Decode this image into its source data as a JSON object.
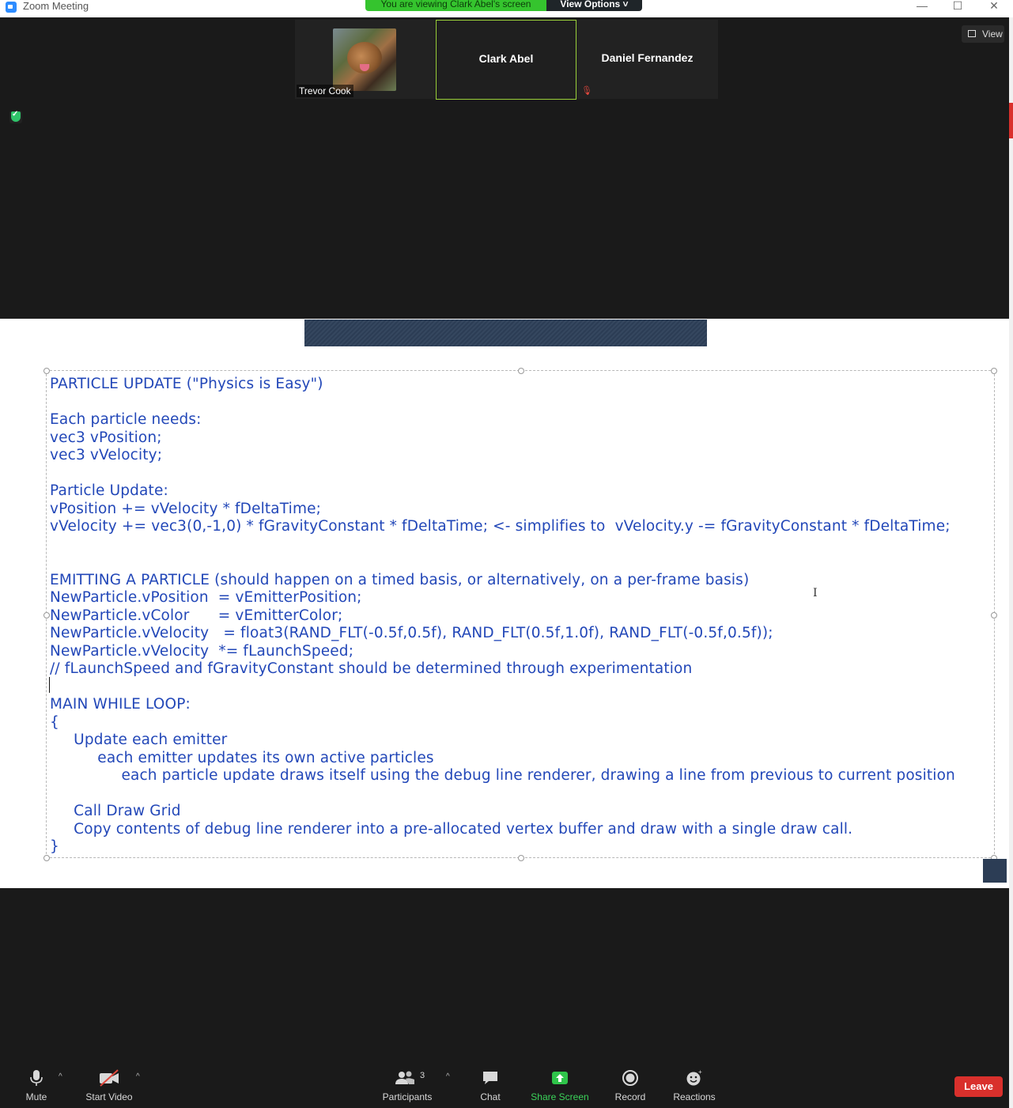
{
  "window": {
    "title": "Zoom Meeting",
    "viewing_banner": "You are viewing Clark Abel's screen",
    "view_options": "View Options ˅",
    "controls": [
      "—",
      "☐",
      "✕"
    ]
  },
  "participants_strip": {
    "trevor": "Trevor Cook",
    "clark": "Clark Abel",
    "daniel": "Daniel Fernandez"
  },
  "view_button": "View",
  "shared_screen": {
    "lines": [
      "PARTICLE UPDATE (\"Physics is Easy\")",
      "",
      "Each particle needs:",
      "vec3 vPosition;",
      "vec3 vVelocity;",
      "",
      "Particle Update:",
      "vPosition += vVelocity * fDeltaTime;",
      "vVelocity += vec3(0,-1,0) * fGravityConstant * fDeltaTime; <- simplifies to  vVelocity.y -= fGravityConstant * fDeltaTime;",
      "",
      "",
      "EMITTING A PARTICLE (should happen on a timed basis, or alternatively, on a per-frame basis)",
      "NewParticle.vPosition  = vEmitterPosition;",
      "NewParticle.vColor      = vEmitterColor;",
      "NewParticle.vVelocity   = float3(RAND_FLT(-0.5f,0.5f), RAND_FLT(0.5f,1.0f), RAND_FLT(-0.5f,0.5f));",
      "NewParticle.vVelocity  *= fLaunchSpeed;",
      "// fLaunchSpeed and fGravityConstant should be determined through experimentation",
      "",
      "MAIN WHILE LOOP:",
      "{",
      "     Update each emitter",
      "          each emitter updates its own active particles",
      "               each particle update draws itself using the debug line renderer, drawing a line from previous to current position",
      "",
      "     Call Draw Grid",
      "     Copy contents of debug line renderer into a pre-allocated vertex buffer and draw with a single draw call.",
      "}"
    ]
  },
  "toolbar": {
    "mute": "Mute",
    "start_video": "Start Video",
    "participants": "Participants",
    "participants_count": "3",
    "chat": "Chat",
    "share_screen": "Share Screen",
    "record": "Record",
    "reactions": "Reactions",
    "leave": "Leave"
  },
  "colors": {
    "accent_green": "#35c42e",
    "code_blue": "#2247b8",
    "leave_red": "#d9302c"
  }
}
